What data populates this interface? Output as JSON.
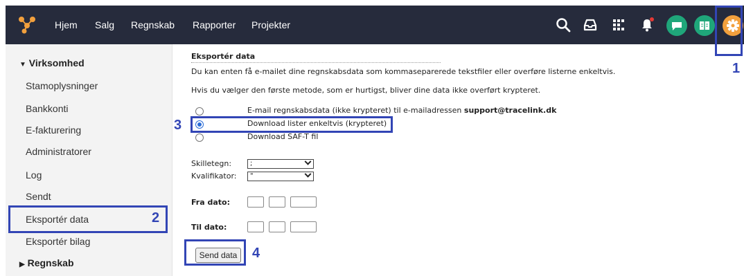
{
  "nav": {
    "items": [
      "Hjem",
      "Salg",
      "Regnskab",
      "Rapporter",
      "Projekter"
    ]
  },
  "icons": {
    "search": "search-icon",
    "inbox": "inbox-icon",
    "apps": "apps-grid-icon",
    "bell": "bell-icon",
    "chat": "chat-icon",
    "guide": "book-icon",
    "settings": "gear-icon"
  },
  "colors": {
    "topbar": "#262b3c",
    "chat": "#1fa67a",
    "guide": "#1fa67a",
    "settings": "#f2a03d",
    "annotation": "#3245b5",
    "radio_selected": "#2a6cd6"
  },
  "sidebar": {
    "section_open": "Virksomhed",
    "items": [
      "Stamoplysninger",
      "Bankkonti",
      "E-fakturering",
      "Administratorer",
      "Log",
      "Sendt",
      "Eksportér data",
      "Eksportér bilag"
    ],
    "section_closed": "Regnskab"
  },
  "main": {
    "title": "Eksportér data",
    "intro1": "Du kan enten få e-mailet dine regnskabsdata som kommaseparerede tekstfiler eller overføre listerne enkeltvis.",
    "intro2": "Hvis du vælger den første metode, som er hurtigst, bliver dine data ikke overført krypteret.",
    "option1_prefix": "E-mail regnskabsdata (ikke krypteret) til e-mailadressen ",
    "option1_email": "support@tracelink.dk",
    "option2": "Download lister enkeltvis (krypteret)",
    "option3": "Download SAF-T fil",
    "separator_label": "Skilletegn:",
    "separator_value": ";",
    "qualifier_label": "Kvalifikator:",
    "qualifier_value": "\"",
    "from_label": "Fra dato:",
    "to_label": "Til dato:",
    "send_button": "Send data"
  },
  "annotations": {
    "n1": "1",
    "n2": "2",
    "n3": "3",
    "n4": "4"
  }
}
